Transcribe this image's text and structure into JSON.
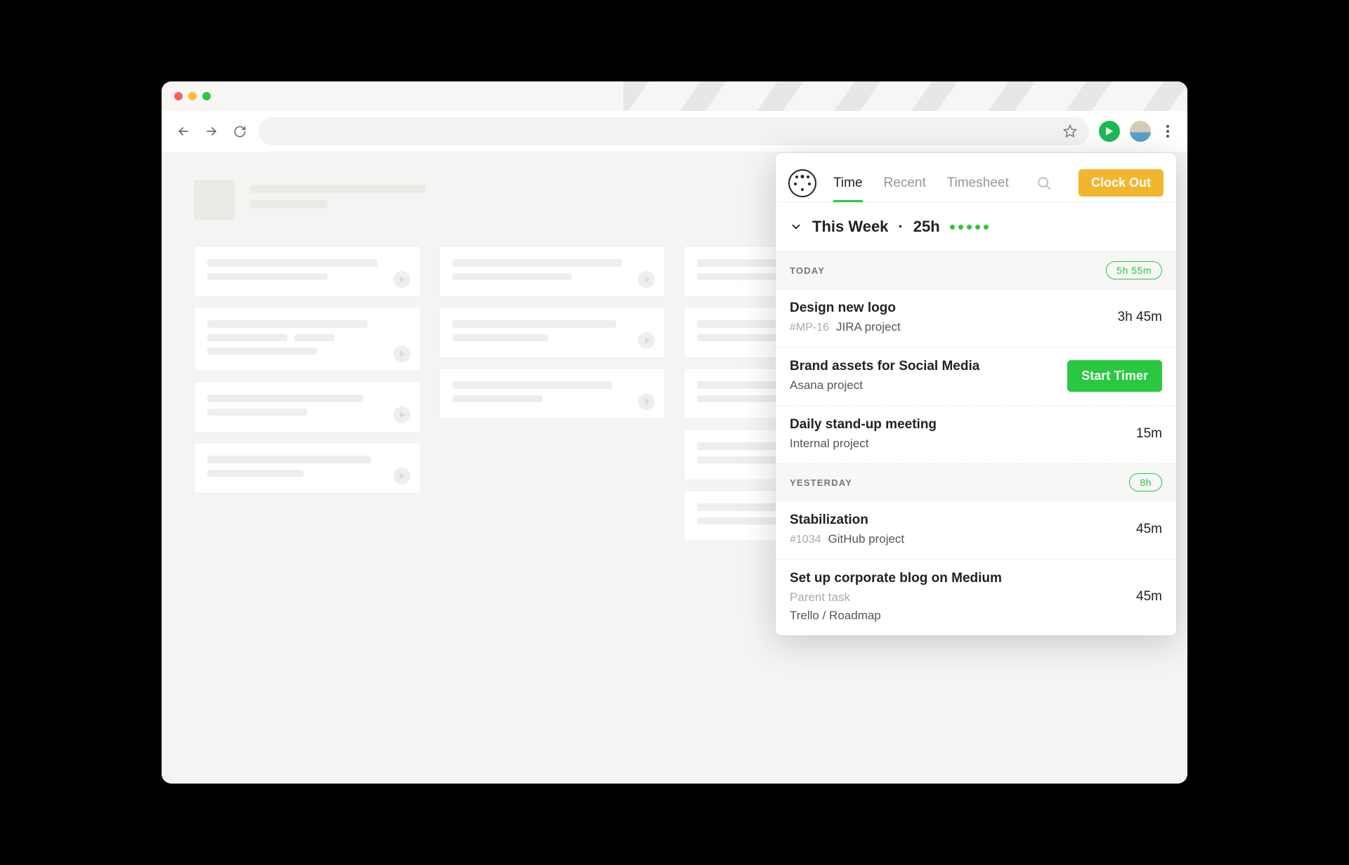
{
  "popover": {
    "tabs": {
      "time": "Time",
      "recent": "Recent",
      "timesheet": "Timesheet"
    },
    "clock_out_label": "Clock Out",
    "summary": {
      "period": "This Week",
      "hours": "25h"
    },
    "sections": [
      {
        "label": "TODAY",
        "total": "5h 55m",
        "entries": [
          {
            "title": "Design new logo",
            "tag": "#MP-16",
            "project": "JIRA project",
            "time": "3h 45m"
          },
          {
            "title": "Brand assets for Social Media",
            "project": "Asana project",
            "start_label": "Start Timer"
          },
          {
            "title": "Daily stand-up meeting",
            "project": "Internal project",
            "time": "15m"
          }
        ]
      },
      {
        "label": "YESTERDAY",
        "total": "8h",
        "entries": [
          {
            "title": "Stabilization",
            "tag": "#1034",
            "project": "GitHub project",
            "time": "45m"
          },
          {
            "title": "Set up corporate blog on Medium",
            "parent": "Parent task",
            "project": "Trello / Roadmap",
            "time": "45m"
          }
        ]
      }
    ]
  }
}
